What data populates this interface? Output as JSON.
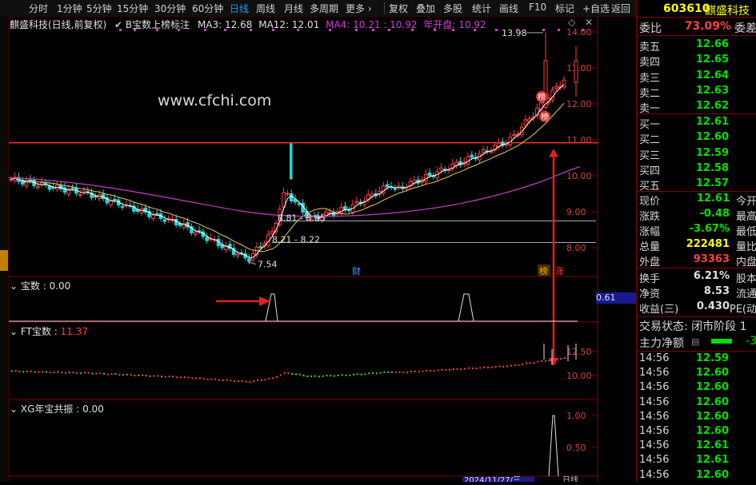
{
  "toolbar": {
    "periods": [
      "分时",
      "1分钟",
      "5分钟",
      "15分钟",
      "30分钟",
      "60分钟",
      "日线",
      "周线",
      "月线",
      "多周期",
      "更多"
    ],
    "active_period": "日线",
    "actions": [
      "复权",
      "叠加",
      "多股",
      "统计",
      "画线",
      "F10",
      "标记",
      "+自选",
      "返回"
    ]
  },
  "main_panel": {
    "title": "麒盛科技(日线,前复权)",
    "indicator_name": "B宝数上榜标注",
    "ma3": "MA3: 12.68",
    "ma12": "MA12: 12.01",
    "ma4": "MA4: 10.21",
    "ma4_extra": ": 10.92",
    "year_open": "年开盘: 10.92",
    "watermark": "www.cfchi.com",
    "price_ticks": [
      "14.00",
      "13.00",
      "12.00",
      "11.00",
      "10.00",
      "9.00",
      "8.00"
    ],
    "annotations": {
      "high": "13.98",
      "low": "7.54",
      "range1": "8.81 - 8.85",
      "range2": "8.21 - 8.22",
      "marker_cai": "财",
      "marker_bang": "榜",
      "marker_zhang": "涨",
      "badge_bang": "榜"
    }
  },
  "panel_baoshu": {
    "title": "宝数 : 0.00",
    "side_value": "0.61"
  },
  "panel_ft": {
    "title": "FT宝数 :",
    "value": "11.37",
    "ticks": [
      "12.50",
      "10.00"
    ]
  },
  "panel_xg": {
    "title": "XG年宝共振 : 0.00",
    "ticks": [
      "1.00",
      "0.50"
    ]
  },
  "bottom_axis": {
    "date_label": "2024/11/27/三",
    "right_label": "日线"
  },
  "quote": {
    "code": "603610",
    "name": "麒盛科技",
    "weibi_label": "委比",
    "weibi_value": "73.09%",
    "weicha_label": "委差",
    "sells": [
      {
        "label": "卖五",
        "price": "12.66"
      },
      {
        "label": "卖四",
        "price": "12.65"
      },
      {
        "label": "卖三",
        "price": "12.64"
      },
      {
        "label": "卖二",
        "price": "12.63"
      },
      {
        "label": "卖一",
        "price": "12.62"
      }
    ],
    "buys": [
      {
        "label": "买一",
        "price": "12.61"
      },
      {
        "label": "买二",
        "price": "12.60"
      },
      {
        "label": "买三",
        "price": "12.59"
      },
      {
        "label": "买四",
        "price": "12.58"
      },
      {
        "label": "买五",
        "price": "12.57"
      }
    ],
    "stats": [
      {
        "label": "现价",
        "value": "12.61",
        "extra": "今开",
        "color": "green"
      },
      {
        "label": "涨跌",
        "value": "-0.48",
        "extra": "最高",
        "color": "green"
      },
      {
        "label": "涨幅",
        "value": "-3.67%",
        "extra": "最低",
        "color": "green"
      },
      {
        "label": "总量",
        "value": "222481",
        "extra": "量比",
        "color": "yellow"
      },
      {
        "label": "外盘",
        "value": "93363",
        "extra": "内盘",
        "color": "red"
      }
    ],
    "stats2": [
      {
        "label": "换手",
        "value": "6.21%",
        "extra": "股本"
      },
      {
        "label": "净资",
        "value": "8.53",
        "extra": "流通"
      },
      {
        "label": "收益(三)",
        "value": "0.430",
        "extra": "PE(动"
      }
    ],
    "trade_state": "交易状态: 闭市阶段 1",
    "main_net": "主力净额",
    "main_net_value": "-3",
    "ticks": [
      {
        "time": "14:56",
        "price": "12.59"
      },
      {
        "time": "14:56",
        "price": "12.60"
      },
      {
        "time": "14:56",
        "price": "12.60"
      },
      {
        "time": "14:56",
        "price": "12.60"
      },
      {
        "time": "14:56",
        "price": "12.60"
      },
      {
        "time": "14:56",
        "price": "12.60"
      },
      {
        "time": "14:56",
        "price": "12.61"
      },
      {
        "time": "14:56",
        "price": "12.61"
      },
      {
        "time": "14:56",
        "price": "12.60"
      }
    ]
  }
}
